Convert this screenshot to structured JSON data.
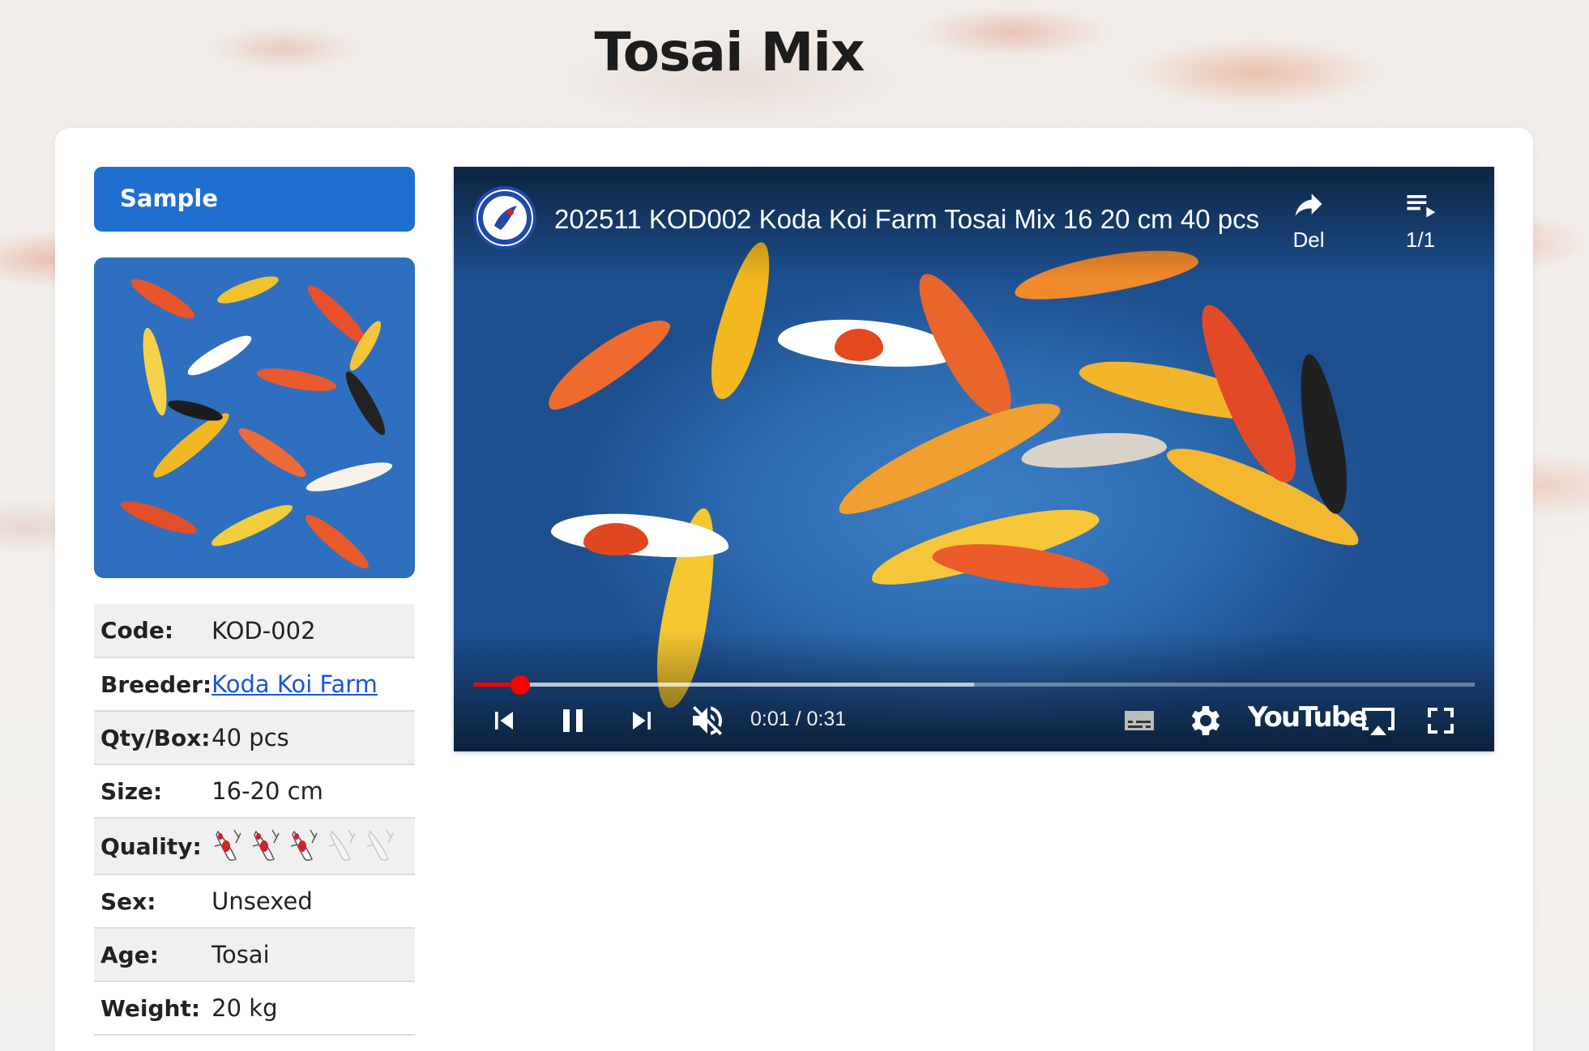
{
  "page": {
    "title": "Tosai Mix"
  },
  "sidebar": {
    "header": "Sample",
    "details": [
      {
        "label": "Code:",
        "value": "KOD-002"
      },
      {
        "label": "Breeder:",
        "value": "Koda Koi Farm"
      },
      {
        "label": "Qty/Box:",
        "value": "40 pcs"
      },
      {
        "label": "Size:",
        "value": "16-20 cm"
      },
      {
        "label": "Quality:",
        "rating": 3,
        "max_rating": 5
      },
      {
        "label": "Sex:",
        "value": "Unsexed"
      },
      {
        "label": "Age:",
        "value": "Tosai"
      },
      {
        "label": "Weight:",
        "value": "20 kg"
      }
    ]
  },
  "video": {
    "title": "202511 KOD002 Koda Koi Farm Tosai Mix 16 20 cm 40 pcs",
    "share_label": "Del",
    "playlist_label": "1/1",
    "time": "0:01 / 0:31",
    "played_fraction": 0.047,
    "buffered_fraction": 0.5,
    "brand": "YouTube",
    "icons": [
      "previous-icon",
      "pause-icon",
      "next-icon",
      "mute-icon",
      "subtitles-icon",
      "settings-icon",
      "airplay-icon",
      "fullscreen-icon",
      "share-icon",
      "playlist-icon"
    ]
  },
  "colors": {
    "accent": "#1f6fd1",
    "link": "#1a56d6",
    "progress": "#ff0000"
  }
}
